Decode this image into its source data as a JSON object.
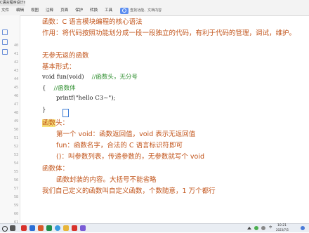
{
  "window": {
    "file_name": "C语言程序设计new.pdf"
  },
  "menu": {
    "items": [
      "文件",
      "编辑",
      "视图",
      "注释",
      "页面",
      "保护",
      "转换",
      "工具"
    ],
    "search_placeholder": "查找功能、文档内容"
  },
  "gutter": {
    "line_numbers": [
      "40",
      "41",
      "42",
      "43",
      "44",
      "45",
      "46",
      "47",
      "48",
      "49",
      "50",
      "51",
      "52",
      "53",
      "54",
      "55",
      "56",
      "57",
      "58",
      "59",
      "60",
      "61",
      "62"
    ]
  },
  "document": {
    "line1": "函数：C 语言模块编程的核心语法",
    "line2": "作用：将代码按照功能划分成一段一段独立的代码，有利于代码的管理，调试，维护。",
    "line3": "无参无返的函数",
    "line4": "基本形式：",
    "code1_code": "void fun(void)",
    "code1_comment": "//函数头，无分号",
    "code2_brace": "{",
    "code2_comment": "//函数体",
    "code3": "printf(\"hello C3~\");",
    "code4": "}",
    "line5_highlight": "函数",
    "line5_rest": "头：",
    "line6": "第一个 void：函数返回值，void 表示无返回值",
    "line7": "fun：函数名字，合法的 C 语言标识符即可",
    "line8": "()：叫参数列表，传递参数的，无参数就写个 void",
    "line9": "函数体：",
    "line10": "函数封装的内容。大括号不能省略",
    "line11": "我们自己定义的函数叫自定义函数，个数随意，1 万个都行"
  },
  "taskbar": {
    "tray_lang": "中",
    "tray_time": "10:21",
    "tray_date": "2023/7/5",
    "icon_colors": {
      "wps": "#d8322b",
      "word": "#2b6fd6",
      "ppt": "#d85a2b",
      "excel": "#1f8f4a",
      "browser": "#3b9be0",
      "folder": "#e8b53a",
      "pdf": "#d8322b"
    }
  },
  "colors": {
    "accent_text": "#c2541a",
    "comment": "#2f8f2f",
    "highlight": "#f6e27a"
  }
}
